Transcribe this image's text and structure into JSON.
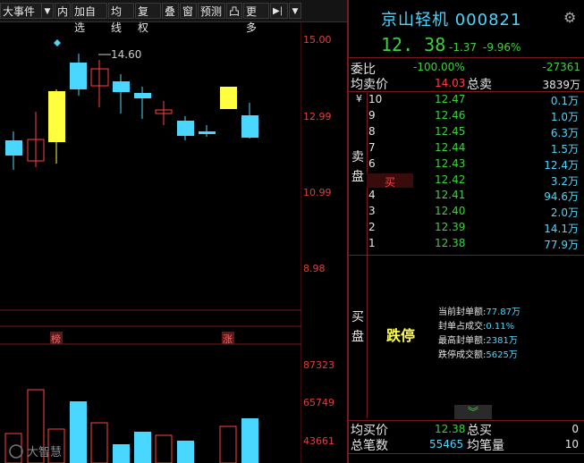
{
  "toolbar": {
    "items": [
      "大事件",
      "▼",
      "内",
      "加自选",
      "均线",
      "复权",
      "叠",
      "窗",
      "预测",
      "凸",
      "更多",
      "▶|",
      "▼"
    ]
  },
  "chart": {
    "price_labels": [
      "15.00",
      "12.99",
      "10.99",
      "8.98"
    ],
    "hi_label": "14.60",
    "markers": [
      "榜",
      "涨"
    ],
    "volume_labels": [
      "87323",
      "65749",
      "43661"
    ]
  },
  "stock": {
    "name": "京山轻机",
    "code": "000821",
    "price": "12. 38",
    "change": "-1.37",
    "change_pct": "-9.96%"
  },
  "summary": {
    "wb_label": "委比",
    "wb_pct": "-100.00%",
    "wb_val": "-27361",
    "avg_sell_label": "均卖价",
    "avg_sell": "14.03",
    "total_sell_label": "总卖",
    "total_sell": "3839万"
  },
  "sell_side_label": [
    "卖",
    "盘"
  ],
  "sell_rows": [
    {
      "lvl": "10",
      "px": "12.47",
      "vol": "0.1万"
    },
    {
      "lvl": "9",
      "px": "12.46",
      "vol": "1.0万"
    },
    {
      "lvl": "8",
      "px": "12.45",
      "vol": "6.3万"
    },
    {
      "lvl": "7",
      "px": "12.44",
      "vol": "1.5万"
    },
    {
      "lvl": "6",
      "px": "12.43",
      "vol": "12.4万"
    },
    {
      "lvl": "5",
      "px": "12.42",
      "vol": "3.2万"
    },
    {
      "lvl": "4",
      "px": "12.41",
      "vol": "94.6万"
    },
    {
      "lvl": "3",
      "px": "12.40",
      "vol": "2.0万"
    },
    {
      "lvl": "2",
      "px": "12.39",
      "vol": "14.1万"
    },
    {
      "lvl": "1",
      "px": "12.38",
      "vol": "77.9万"
    }
  ],
  "yen_symbol": "¥",
  "buy_tag": "买",
  "buy_side_label": [
    "买",
    "盘"
  ],
  "limit": {
    "status": "跌停",
    "lines": [
      {
        "k": "当前封单额:",
        "v": "77.87万"
      },
      {
        "k": "封单占成交:",
        "v": "0.11%"
      },
      {
        "k": "最高封单额:",
        "v": "2381万"
      },
      {
        "k": "跌停成交额:",
        "v": "5625万"
      }
    ]
  },
  "footer": {
    "avg_buy_label": "均买价",
    "avg_buy": "12.38",
    "total_buy_label": "总买",
    "total_buy": "0",
    "total_trades_label": "总笔数",
    "total_trades": "55465",
    "avg_vol_label": "均笔量",
    "avg_vol": "10"
  },
  "watermark": "大智慧",
  "colors": {
    "up": "#ff4040",
    "down": "#3cd13c",
    "cyan": "#49d7ff",
    "yellow": "#ffff40",
    "frame": "#7a1a1a"
  }
}
